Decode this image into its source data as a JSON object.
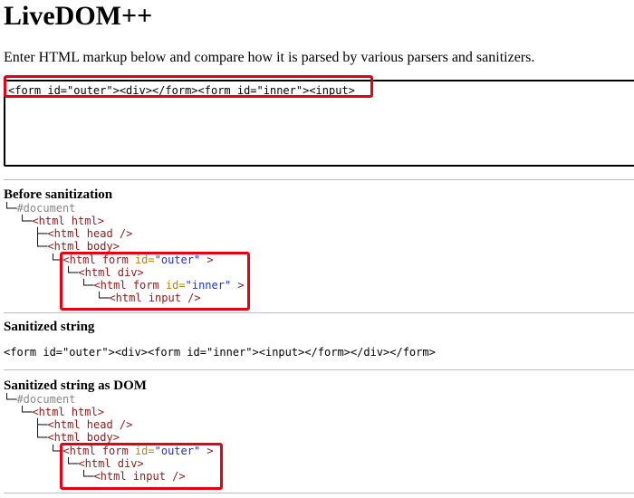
{
  "app": {
    "title": "LiveDOM++",
    "intro": "Enter HTML markup below and compare how it is parsed by various parsers and sanitizers."
  },
  "input": {
    "value": "<form id=\"outer\"><div></form><form id=\"inner\"><input>"
  },
  "before": {
    "heading": "Before sanitization",
    "tree": {
      "document": "#document",
      "html": "<html html>",
      "head_open": "<html head",
      "head_close": " />",
      "body": "<html body>",
      "form_outer_open": "<html form ",
      "form_outer_attr": "id=",
      "form_outer_val": "\"outer\"",
      "form_outer_close": " >",
      "div": "<html div>",
      "form_inner_open": "<html form ",
      "form_inner_attr": "id=",
      "form_inner_val": "\"inner\"",
      "form_inner_close": " >",
      "input_open": "<html input",
      "input_close": " />"
    }
  },
  "sanitized": {
    "heading": "Sanitized string",
    "value": "<form id=\"outer\"><div><form id=\"inner\"><input></form></div></form>"
  },
  "after": {
    "heading": "Sanitized string as DOM",
    "tree": {
      "document": "#document",
      "html": "<html html>",
      "head_open": "<html head",
      "head_close": " />",
      "body": "<html body>",
      "form_outer_open": "<html form ",
      "form_outer_attr": "id=",
      "form_outer_val": "\"outer\"",
      "form_outer_close": " >",
      "div": "<html div>",
      "input_open": "<html input",
      "input_close": " />"
    }
  },
  "colors": {
    "highlight": "#e60012",
    "node": "#8b1a1a",
    "attr_name": "#b8860b",
    "attr_value": "#1f2fd1",
    "document_node": "#888888"
  }
}
